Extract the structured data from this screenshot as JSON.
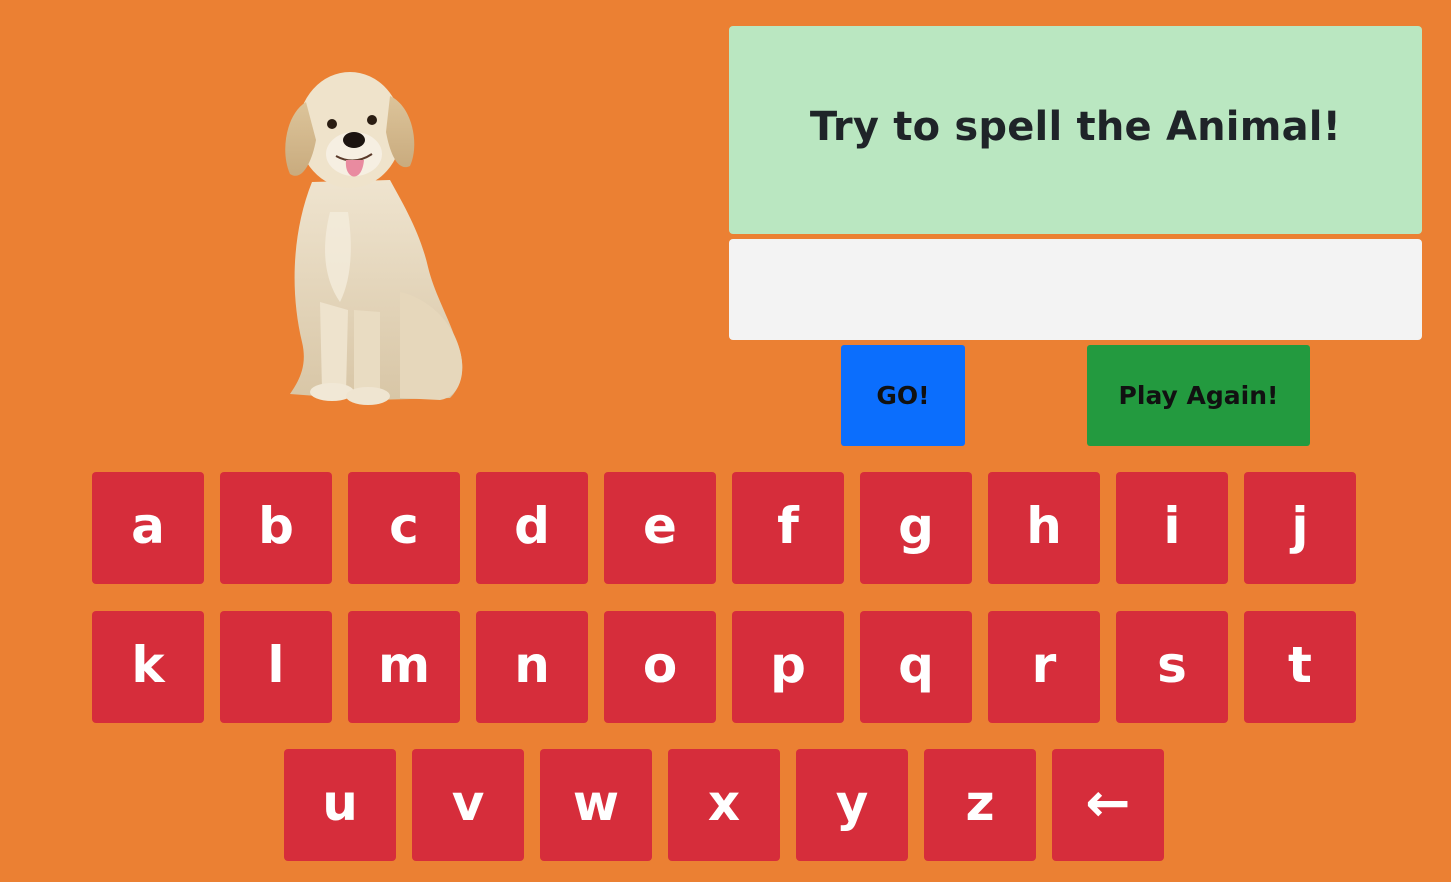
{
  "prompt": {
    "text": "Try to spell the Animal!"
  },
  "answer": {
    "value": "",
    "placeholder": ""
  },
  "buttons": {
    "go": "GO!",
    "play_again": "Play Again!"
  },
  "animal_image": {
    "icon": "dog-photo"
  },
  "keyboard": {
    "row1": [
      "a",
      "b",
      "c",
      "d",
      "e",
      "f",
      "g",
      "h",
      "i",
      "j"
    ],
    "row2": [
      "k",
      "l",
      "m",
      "n",
      "o",
      "p",
      "q",
      "r",
      "s",
      "t"
    ],
    "row3": [
      "u",
      "v",
      "w",
      "x",
      "y",
      "z"
    ],
    "backspace": "←"
  },
  "colors": {
    "background": "#eb8033",
    "prompt_bg": "#bae7c1",
    "answer_bg": "#f3f3f3",
    "go_button": "#0b6efd",
    "play_again_button": "#239a3f",
    "key": "#d62d3b"
  }
}
